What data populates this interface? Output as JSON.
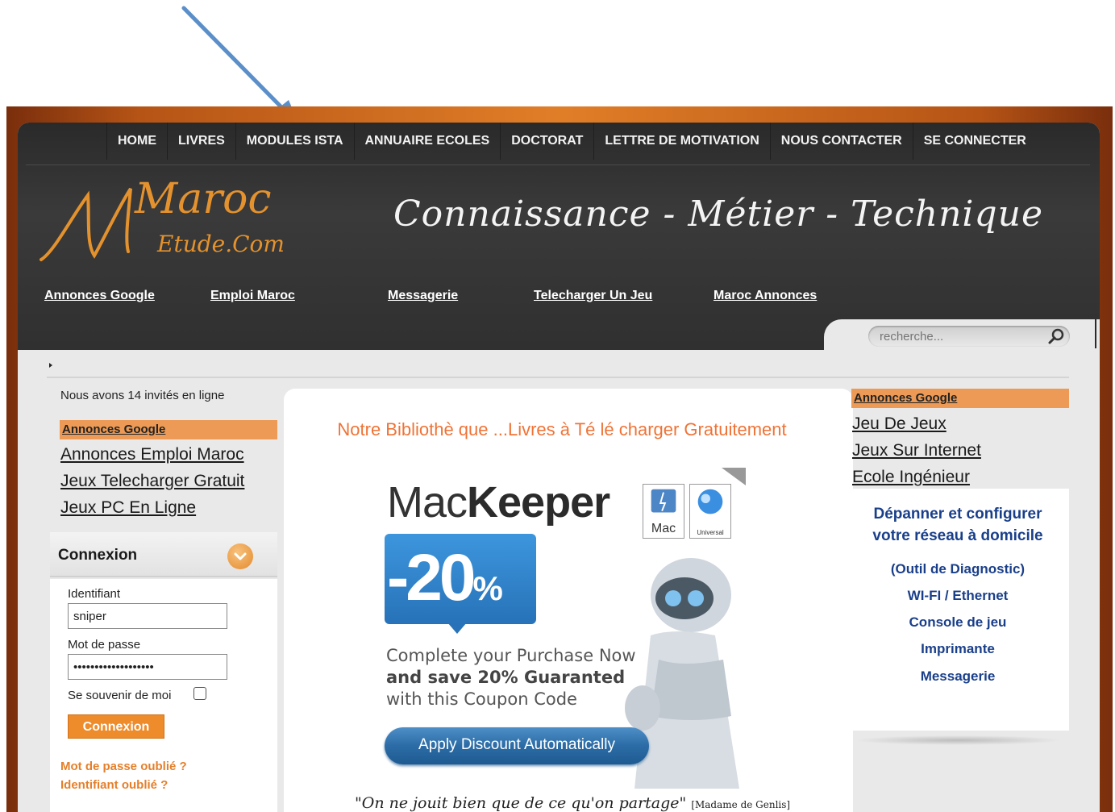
{
  "topnav": {
    "items": [
      "HOME",
      "LIVRES",
      "MODULES ISTA",
      "ANNUAIRE ECOLES",
      "DOCTORAT",
      "LETTRE DE MOTIVATION",
      "NOUS CONTACTER",
      "SE CONNECTER"
    ]
  },
  "logo": {
    "line1": "Maroc",
    "line2": "Etude.Com"
  },
  "tagline": "Connaissance - Métier - Technique",
  "subnav": [
    "Annonces Google",
    "Emploi Maroc",
    "Messagerie",
    "Telecharger Un Jeu",
    "Maroc Annonces"
  ],
  "search": {
    "placeholder": "recherche..."
  },
  "left": {
    "online": "Nous avons 14 invités en ligne",
    "ads_header": "Annonces Google",
    "ads_links": [
      "Annonces Emploi Maroc",
      "Jeux Telecharger Gratuit",
      "Jeux PC En Ligne"
    ],
    "login_title": "Connexion",
    "username_label": "Identifiant",
    "username_value": "sniper",
    "password_label": "Mot de passe",
    "password_value": "•••••••••••••••••••",
    "remember_label": "Se souvenir de moi",
    "login_button": "Connexion",
    "forgot_password": "Mot de passe oublié ?",
    "forgot_username": "Identifiant oublié ?"
  },
  "center": {
    "title": "Notre Bibliothè que ...Livres à  Té lé charger Gratuitement",
    "ad": {
      "brand_light": "Mac",
      "brand_bold": "Keeper",
      "os_mac": "Mac",
      "os_universal": "Universal",
      "discount": "-20",
      "percent": "%",
      "copy1": "Complete your Purchase Now",
      "copy2": "and save 20% Guaranted",
      "copy3": "with this Coupon Code",
      "button": "Apply Discount Automatically"
    },
    "quote": "\"On ne jouit bien que de ce qu'on partage\"",
    "quote_author": "[Madame de Genlis]"
  },
  "right": {
    "ads_header": "Annonces Google",
    "ads_links": [
      "Jeu De Jeux",
      "Jeux Sur Internet",
      "Ecole Ingénieur"
    ],
    "promo_title_1": "Dépanner et configurer",
    "promo_title_2": "votre réseau à domicile",
    "promo_items": [
      "(Outil de Diagnostic)",
      "WI-FI / Ethernet",
      "Console de jeu",
      "Imprimante",
      "Messagerie"
    ]
  },
  "colors": {
    "accent_orange": "#ec9a55",
    "header_dark": "#333333",
    "link_blue": "#1a3f8a",
    "arrow_blue": "#5b8fc9"
  }
}
